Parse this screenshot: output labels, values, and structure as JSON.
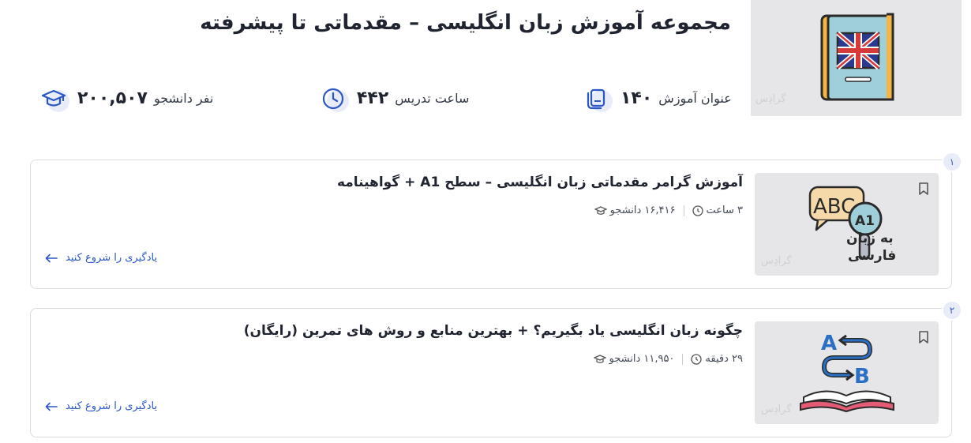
{
  "header": {
    "title": "مجموعه آموزش زبان انگلیسی – مقدماتی تا پیشرفته",
    "image_watermark": "گرادِس",
    "image_icon": "english-book-flag-icon"
  },
  "stats": [
    {
      "icon": "courses-icon",
      "number": "۱۴۰",
      "label": "عنوان آموزش"
    },
    {
      "icon": "clock-icon",
      "number": "۴۴۲",
      "label": "ساعت تدریس"
    },
    {
      "icon": "graduation-cap-icon",
      "number": "۲۰۰,۵۰۷",
      "label": "نفر دانشجو"
    }
  ],
  "courses": [
    {
      "index": "۱",
      "title": "آموزش گرامر مقدماتی زبان انگلیسی – سطح A1 + گواهینامه",
      "students": "۱۶,۴۱۶ دانشجو",
      "duration": "۳ ساعت",
      "cta": "یادگیری را شروع کنید",
      "thumb_watermark": "گرادِس",
      "thumb_icon": "abc-a1-magnifier-icon",
      "thumb_text_line1": "به زبان",
      "thumb_text_line2": "فارسی"
    },
    {
      "index": "۲",
      "title": "چگونه زبان انگلیسی یاد بگیریم؟ + بهترین منابع و روش های تمرین (رایگان)",
      "students": "۱۱,۹۵۰ دانشجو",
      "duration": "۲۹ دقیقه",
      "cta": "یادگیری را شروع کنید",
      "thumb_watermark": "گرادِس",
      "thumb_icon": "a-to-b-book-icon"
    }
  ],
  "colors": {
    "accent": "#2a56c6",
    "badge_bg": "#e7ecf8",
    "thumb_bg": "#e6e6e8"
  }
}
